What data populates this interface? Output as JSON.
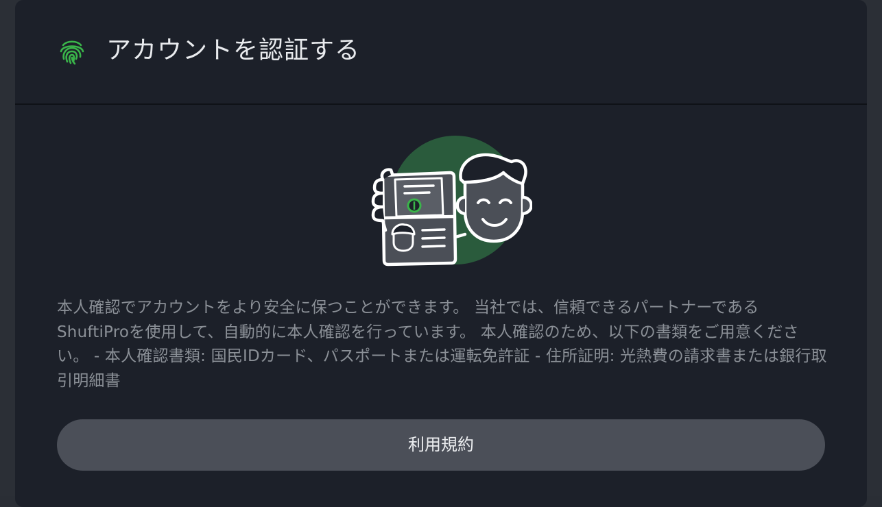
{
  "header": {
    "title": "アカウントを認証する",
    "icon": "fingerprint-icon",
    "icon_color": "#3ab54a"
  },
  "illustration": {
    "icon": "id-verification-illustration",
    "accent_color": "#2a5b3c"
  },
  "body": {
    "description": "本人確認でアカウントをより安全に保つことができます。 当社では、信頼できるパートナーであるShuftiProを使用して、自動的に本人確認を行っています。 本人確認のため、以下の書類をご用意ください。 - 本人確認書類: 国民IDカード、パスポートまたは運転免許証 - 住所証明: 光熱費の請求書または銀行取引明細書"
  },
  "actions": {
    "terms_label": "利用規約"
  }
}
